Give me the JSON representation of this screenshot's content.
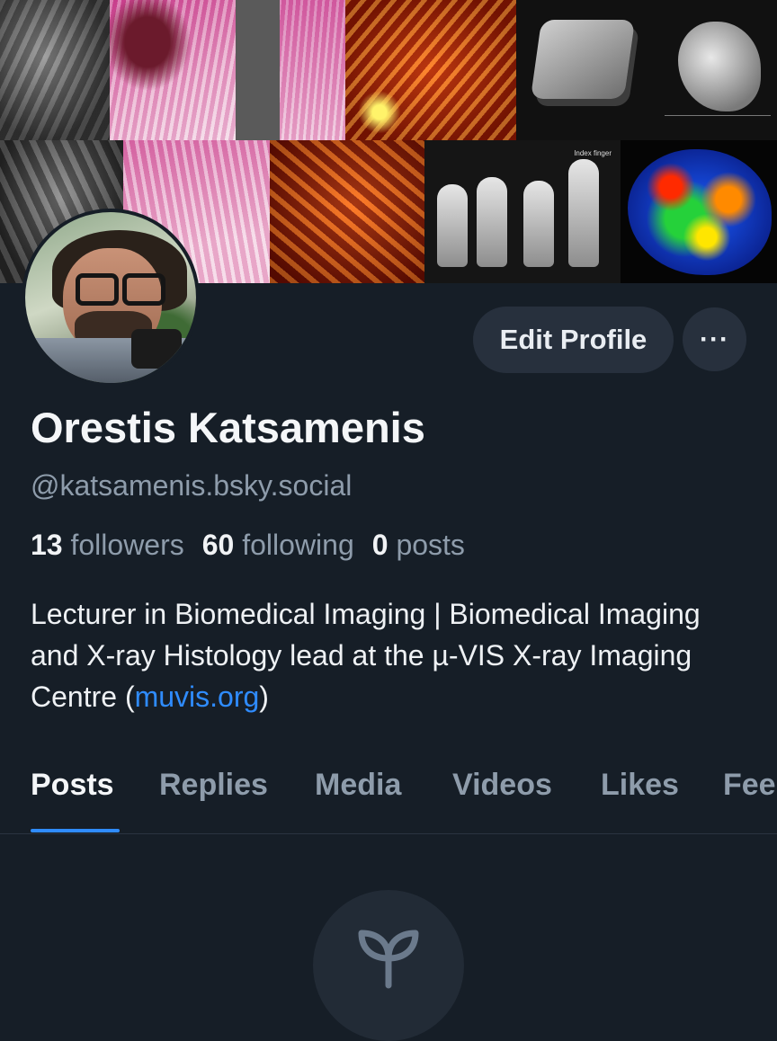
{
  "profile": {
    "display_name": "Orestis Katsamenis",
    "handle": "@katsamenis.bsky.social",
    "stats": {
      "followers_count": "13",
      "followers_label": "followers",
      "following_count": "60",
      "following_label": "following",
      "posts_count": "0",
      "posts_label": "posts"
    },
    "bio_text": "Lecturer in Biomedical Imaging | Biomedical Imaging and X-ray Histology lead at the µ-VIS X-ray Imaging Centre (",
    "bio_link": "muvis.org",
    "bio_end": ")"
  },
  "actions": {
    "edit_profile_label": "Edit Profile",
    "more_label": "···"
  },
  "banner": {
    "finger_panel_label": "Index finger"
  },
  "tabs": [
    {
      "label": "Posts",
      "active": true
    },
    {
      "label": "Replies",
      "active": false
    },
    {
      "label": "Media",
      "active": false
    },
    {
      "label": "Videos",
      "active": false
    },
    {
      "label": "Likes",
      "active": false
    },
    {
      "label": "Fee",
      "active": false
    }
  ],
  "icons": {
    "empty_state": "sprout-icon",
    "more": "ellipsis-icon"
  },
  "colors": {
    "background": "#161e27",
    "accent": "#2f8cff",
    "button_bg": "#27303d",
    "muted_text": "#8e9cab"
  }
}
